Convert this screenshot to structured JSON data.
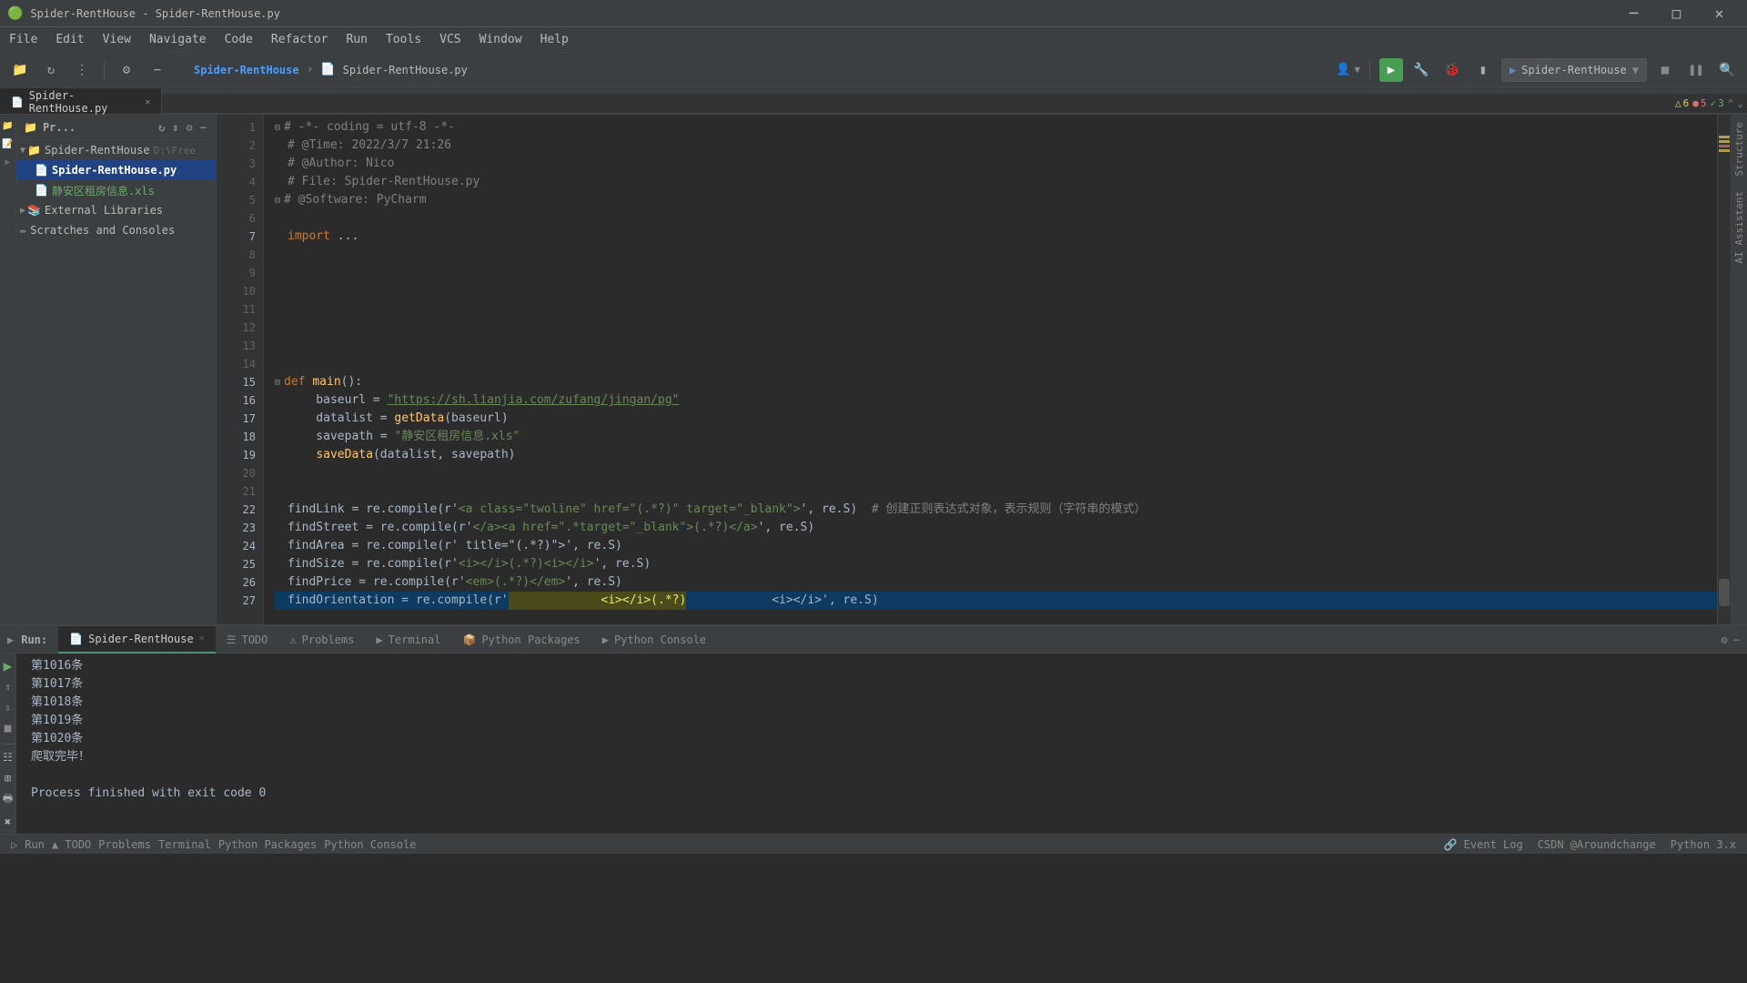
{
  "window": {
    "title": "Spider-RentHouse - Spider-RentHouse.py",
    "minimize": "─",
    "maximize": "□",
    "close": "✕"
  },
  "menu": {
    "items": [
      "File",
      "Edit",
      "View",
      "Navigate",
      "Code",
      "Refactor",
      "Run",
      "Tools",
      "VCS",
      "Window",
      "Help"
    ]
  },
  "toolbar": {
    "breadcrumb_project": "Spider-RentHouse",
    "breadcrumb_file": "Spider-RentHouse.py",
    "project_selector": "Spider-RentHouse",
    "run_config": "Spider-RentHouse"
  },
  "tabs": {
    "editor_tabs": [
      {
        "label": "Spider-RentHouse.py",
        "active": true
      }
    ]
  },
  "project_panel": {
    "title": "Pr...",
    "tree": [
      {
        "level": 0,
        "type": "folder",
        "label": "Spider-RentHouse",
        "suffix": "D:\\Free",
        "expanded": true,
        "arrow": "▼"
      },
      {
        "level": 1,
        "type": "py",
        "label": "Spider-RentHouse.py",
        "active": true
      },
      {
        "level": 1,
        "type": "xls",
        "label": "静安区租房信息.xls"
      },
      {
        "level": 0,
        "type": "ext-lib",
        "label": "External Libraries",
        "expanded": false,
        "arrow": "▶"
      },
      {
        "level": 0,
        "type": "scratch",
        "label": "Scratches and Consoles"
      }
    ]
  },
  "editor": {
    "lines": [
      {
        "num": 1,
        "content": "# -*- coding = utf-8 -*-",
        "type": "comment"
      },
      {
        "num": 2,
        "content": "# @Time: 2022/3/7 21:26",
        "type": "comment"
      },
      {
        "num": 3,
        "content": "# @Author: Nico",
        "type": "comment"
      },
      {
        "num": 4,
        "content": "# File: Spider-RentHouse.py",
        "type": "comment"
      },
      {
        "num": 5,
        "content": "# @Software: PyCharm",
        "type": "comment"
      },
      {
        "num": 6,
        "content": "",
        "type": "blank"
      },
      {
        "num": 7,
        "content": "import ...",
        "type": "code"
      },
      {
        "num": 8,
        "content": "",
        "type": "blank"
      },
      {
        "num": 9,
        "content": "",
        "type": "blank"
      },
      {
        "num": 10,
        "content": "",
        "type": "blank"
      },
      {
        "num": 11,
        "content": "",
        "type": "blank"
      },
      {
        "num": 12,
        "content": "",
        "type": "blank"
      },
      {
        "num": 13,
        "content": "",
        "type": "blank"
      },
      {
        "num": 14,
        "content": "",
        "type": "blank"
      },
      {
        "num": 15,
        "content": "def main():",
        "type": "code"
      },
      {
        "num": 16,
        "content": "    baseurl = \"https://sh.lianjia.com/zufang/jingan/pg\"",
        "type": "code"
      },
      {
        "num": 17,
        "content": "    datalist = getData(baseurl)",
        "type": "code"
      },
      {
        "num": 18,
        "content": "    savepath = \"静安区租房信息.xls\"",
        "type": "code"
      },
      {
        "num": 19,
        "content": "    saveData(datalist, savepath)",
        "type": "code"
      },
      {
        "num": 20,
        "content": "",
        "type": "blank"
      },
      {
        "num": 21,
        "content": "",
        "type": "blank"
      },
      {
        "num": 22,
        "content": "findLink = re.compile(r'<a class=\"twoline\" href=\"(.*?)\" target=\"_blank\">', re.S)  # 创建正则表达式对象，表示规则（字符串的模式）",
        "type": "code"
      },
      {
        "num": 23,
        "content": "findStreet = re.compile(r'</a><a href=\".*target=\"_blank\">(.*?)</a>', re.S)",
        "type": "code"
      },
      {
        "num": 24,
        "content": "findArea = re.compile(r' title=\"(.*?)\">', re.S)",
        "type": "code"
      },
      {
        "num": 25,
        "content": "findSize = re.compile(r'<i></i>(.*?)<i></i>', re.S)",
        "type": "code"
      },
      {
        "num": 26,
        "content": "findPrice = re.compile(r'<em>(.*?)</em>', re.S)",
        "type": "code"
      },
      {
        "num": 27,
        "content": "findOrientation = re.compile(r'              <i></i>(.*?)             <i></i>', re.S)",
        "type": "highlighted"
      }
    ]
  },
  "inspection": {
    "warnings": "6",
    "errors": "5",
    "ok": "3"
  },
  "bottom_panel": {
    "run_tab_label": "Spider-RentHouse",
    "tabs": [
      "Run",
      "TODO",
      "Problems",
      "Terminal",
      "Python Packages",
      "Python Console"
    ],
    "console_lines": [
      "第1016条",
      "第1017条",
      "第1018条",
      "第1019条",
      "第1020条",
      "爬取完毕！",
      "",
      "Process finished with exit code 0"
    ]
  },
  "status_bar": {
    "left": "CSDN @Aroundchange",
    "right": "Python 3.x",
    "event_log": "Event Log"
  }
}
